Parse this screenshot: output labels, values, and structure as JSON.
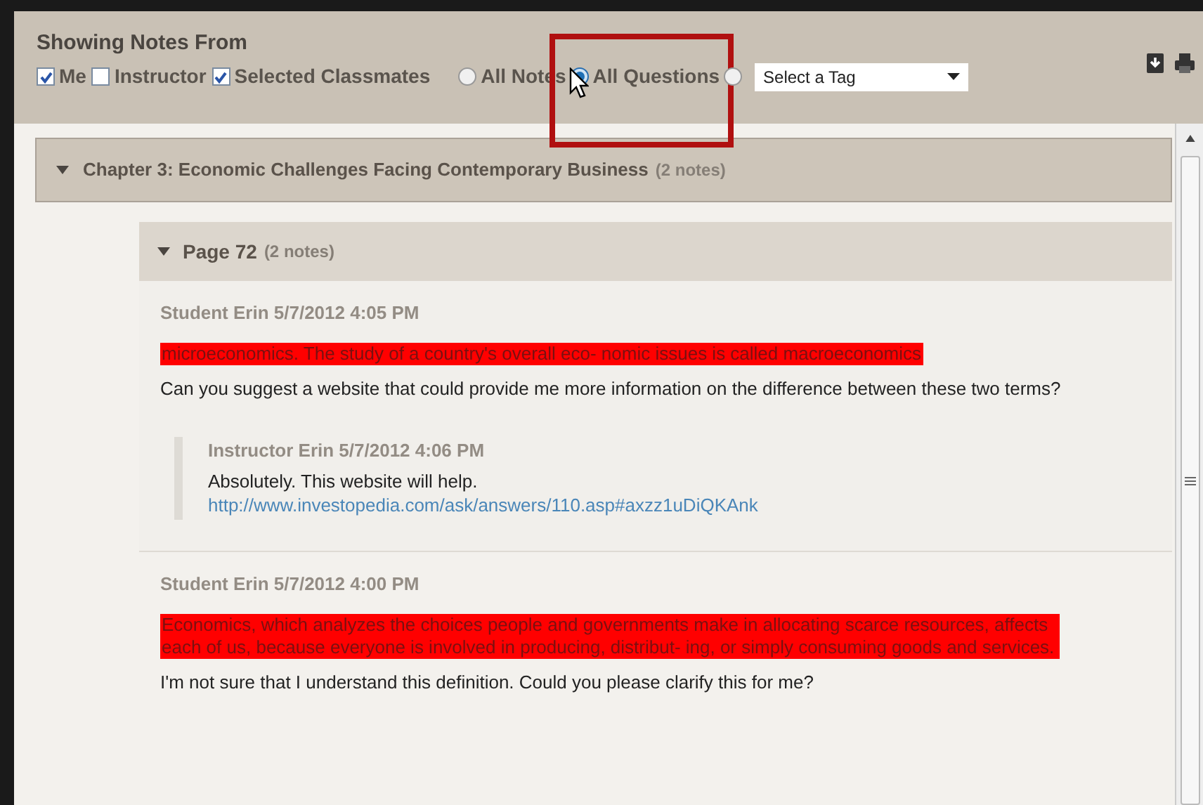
{
  "header": {
    "title": "Showing Notes From",
    "filters": [
      {
        "label": "Me",
        "checked": true
      },
      {
        "label": "Instructor",
        "checked": false
      },
      {
        "label": "Selected Classmates",
        "checked": true
      }
    ],
    "views": [
      {
        "label": "All Notes",
        "selected": false
      },
      {
        "label": "All Questions",
        "selected": true
      },
      {
        "selected": false
      }
    ],
    "tag_select": {
      "value": "Select a Tag"
    }
  },
  "chapter": {
    "title": "Chapter 3: Economic Challenges Facing Contemporary Business",
    "count": "(2 notes)",
    "expanded": true,
    "pages": [
      {
        "title": "Page 72",
        "count": "(2 notes)",
        "expanded": true,
        "notes": [
          {
            "author": "Student Erin 5/7/2012 4:05 PM",
            "highlight": "microeconomics. The study of a country's overall eco- nomic issues is called macroeconomics",
            "text": "Can you suggest a website that could provide me more information on the difference between these two terms?",
            "replies": [
              {
                "author": "Instructor Erin 5/7/2012 4:06 PM",
                "text": "Absolutely. This website will help.",
                "link": "http://www.investopedia.com/ask/answers/110.asp#axzz1uDiQKAnk"
              }
            ]
          },
          {
            "author": "Student Erin 5/7/2012 4:00 PM",
            "highlight": "Economics, which analyzes the choices people and governments make in allocating scarce resources, affects each of us, because everyone is involved in producing, distribut- ing, or simply consuming goods and services.",
            "text": "I'm not sure that I understand this definition. Could you please clarify this for me?"
          }
        ]
      }
    ]
  }
}
